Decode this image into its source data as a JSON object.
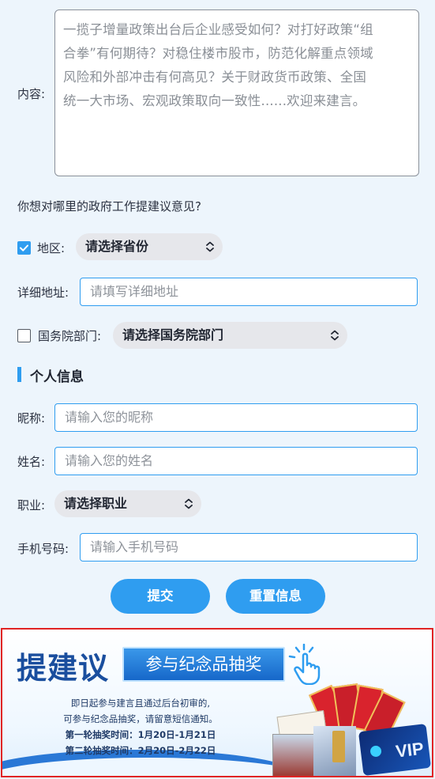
{
  "content": {
    "label": "内容:",
    "placeholder_lines": [
      "一揽子增量政策出台后企业感受如何？对打好政策“组",
      "合拳”有何期待？对稳住楼市股市，防范化解重点领域",
      "风险和外部冲击有何高见？关于财政货币政策、全国",
      "统一大市场、宏观政策取向一致性......欢迎来建言。"
    ]
  },
  "question": "你想对哪里的政府工作提建议意见?",
  "region": {
    "checked": true,
    "label": "地区:",
    "select": "请选择省份"
  },
  "address": {
    "label": "详细地址:",
    "placeholder": "请填写详细地址"
  },
  "state_council": {
    "checked": false,
    "label": "国务院部门:",
    "select": "请选择国务院部门"
  },
  "personal": {
    "title": "个人信息",
    "nickname": {
      "label": "昵称:",
      "placeholder": "请输入您的昵称"
    },
    "name": {
      "label": "姓名:",
      "placeholder": "请输入您的姓名"
    },
    "job": {
      "label": "职业:",
      "select": "请选择职业"
    },
    "phone": {
      "label": "手机号码:",
      "placeholder": "请输入手机号码"
    }
  },
  "buttons": {
    "submit": "提交",
    "reset": "重置信息"
  },
  "banner": {
    "title": "提建议",
    "tag": "参与纪念品抽奖",
    "lines": [
      "即日起参与建言且通过后台初审的,",
      "可参与纪念品抽奖，请留意短信通知。",
      "第一轮抽奖时间：1月20日-1月21日",
      "第二轮抽奖时间：2月20日-2月22日"
    ],
    "card_text": "VIP"
  },
  "colors": {
    "accent": "#2f9df0",
    "banner_blue": "#1a4e9e",
    "highlight_border": "#e02424"
  }
}
